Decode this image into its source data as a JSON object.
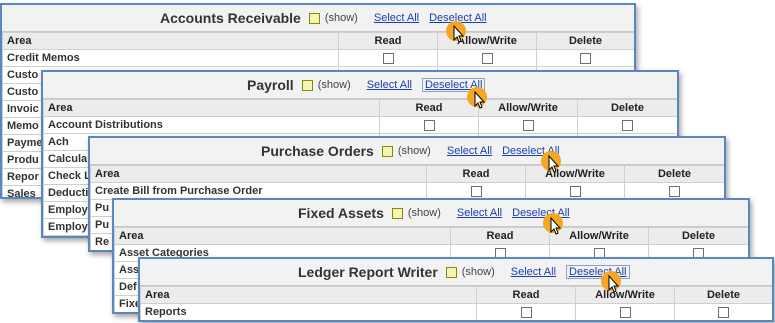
{
  "columns": {
    "area": "Area",
    "read": "Read",
    "write": "Allow/Write",
    "delete": "Delete"
  },
  "show_label": "(show)",
  "select_all": "Select All",
  "deselect_all": "Deselect All",
  "panels": {
    "accounts_receivable": {
      "title": "Accounts Receivable",
      "rows": [
        "Credit Memos",
        "Custo",
        "Custo",
        "Invoic",
        "Memo",
        "Payme",
        "Produ",
        "Repor",
        "Sales"
      ]
    },
    "payroll": {
      "title": "Payroll",
      "rows": [
        "Account Distributions",
        "Ach",
        "Calcula",
        "Check L",
        "Deducti",
        "Employe",
        "Employe"
      ]
    },
    "purchase_orders": {
      "title": "Purchase Orders",
      "rows": [
        "Create Bill from Purchase Order",
        "Pu",
        "Pu",
        "Re"
      ]
    },
    "fixed_assets": {
      "title": "Fixed Assets",
      "rows": [
        "Asset Categories",
        "Ass",
        "Def",
        "Fixe"
      ]
    },
    "ledger_report_writer": {
      "title": "Ledger Report Writer",
      "rows": [
        "Reports"
      ]
    }
  },
  "cursor": {
    "icon": "hand-pointer-icon",
    "highlight_color": "#f5a623"
  }
}
